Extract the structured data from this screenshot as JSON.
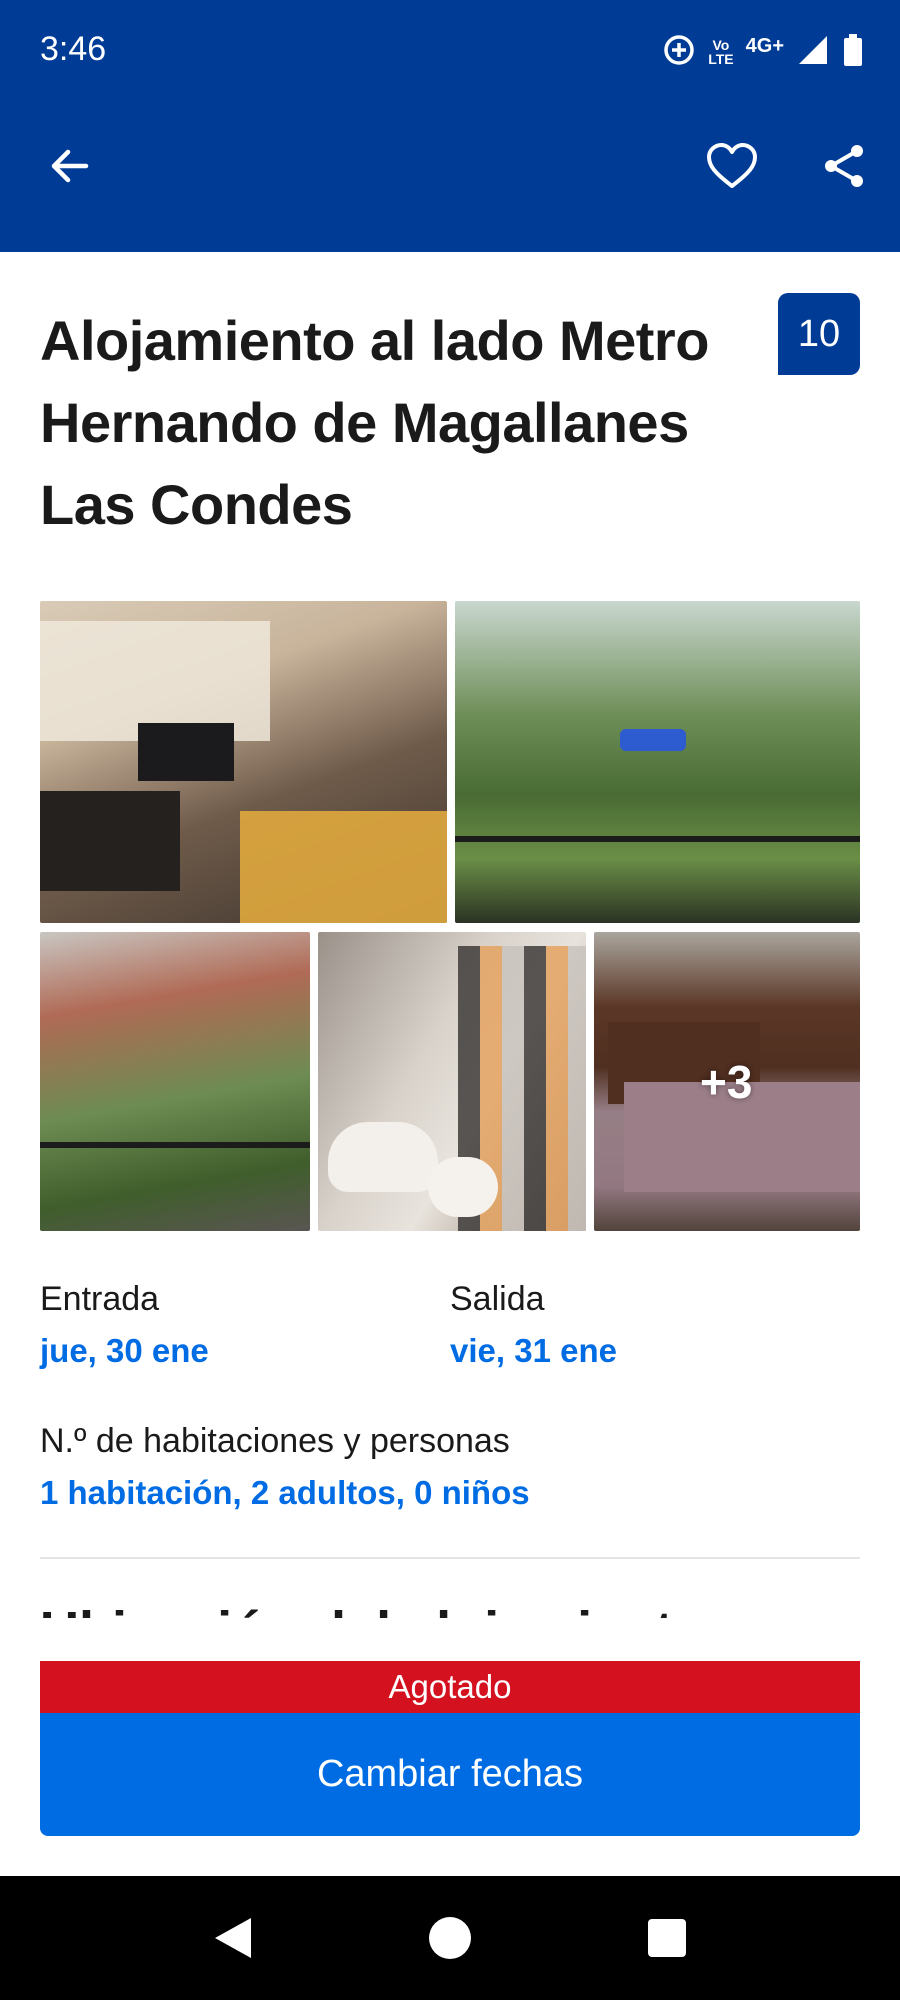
{
  "status_bar": {
    "time": "3:46",
    "volte_top": "Vo",
    "volte_bottom": "LTE",
    "network": "4G+",
    "icons": [
      "data-saver-icon",
      "signal-icon",
      "battery-icon"
    ]
  },
  "app_bar": {
    "icons": [
      "back-arrow-icon",
      "heart-icon",
      "share-icon"
    ]
  },
  "listing": {
    "title": "Alojamiento al lado Metro Hernando de Magallanes Las Condes",
    "score": "10"
  },
  "gallery": {
    "photos": [
      "living-room-photo",
      "garden-view-photo",
      "balcony-photo",
      "bathroom-photo",
      "bedroom-photo"
    ],
    "more_count": "+3"
  },
  "dates": {
    "checkin_label": "Entrada",
    "checkin_value": "jue, 30 ene",
    "checkout_label": "Salida",
    "checkout_value": "vie, 31 ene"
  },
  "occupancy": {
    "label": "N.º de habitaciones y personas",
    "value": "1 habitación, 2 adultos, 0 niños"
  },
  "section_peek": "Ubicación del alojamiento",
  "action": {
    "sold_out": "Agotado",
    "change_dates": "Cambiar fechas"
  },
  "colors": {
    "header_bg": "#003b95",
    "accent_blue": "#006ce4",
    "sold_out_red": "#d4111e"
  }
}
